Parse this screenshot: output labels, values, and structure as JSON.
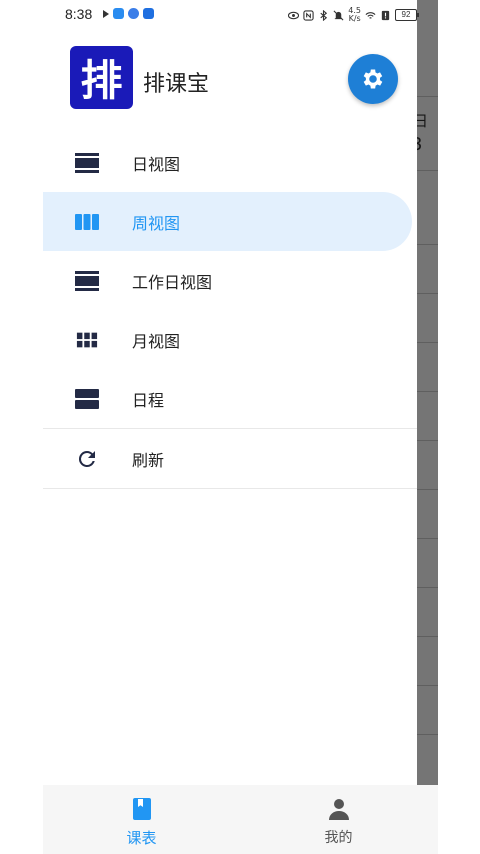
{
  "status_bar": {
    "time": "8:38",
    "battery": "92",
    "speed": "4.5\nK/s"
  },
  "drawer": {
    "logo_char": "排",
    "app_name": "排课宝",
    "items": [
      {
        "label": "日视图",
        "icon": "view-day-icon"
      },
      {
        "label": "周视图",
        "icon": "view-week-icon"
      },
      {
        "label": "工作日视图",
        "icon": "view-workweek-icon"
      },
      {
        "label": "月视图",
        "icon": "view-month-icon"
      },
      {
        "label": "日程",
        "icon": "view-agenda-icon"
      }
    ],
    "refresh_label": "刷新"
  },
  "background": {
    "day": "日",
    "date": "3"
  },
  "bottom_nav": {
    "items": [
      {
        "label": "课表",
        "icon": "book-icon"
      },
      {
        "label": "我的",
        "icon": "person-icon"
      }
    ]
  },
  "colors": {
    "accent": "#2196f3",
    "logo_bg": "#1a1ab8",
    "settings_bg": "#1e7fd6",
    "active_bg": "#e3f0fd",
    "icon_dark": "#232a45"
  }
}
